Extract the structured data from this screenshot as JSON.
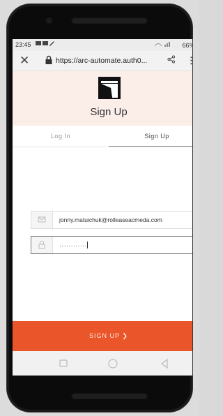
{
  "status_bar": {
    "time": "23:45",
    "battery": "66%"
  },
  "browser": {
    "url": "https://arc-automate.auth0...",
    "close_icon": "close-icon",
    "lock_icon": "lock-icon",
    "share_icon": "share-icon",
    "more_icon": "more-vert-icon"
  },
  "header": {
    "title": "Sign Up"
  },
  "tabs": [
    {
      "label": "Log In"
    },
    {
      "label": "Sign Up"
    }
  ],
  "form": {
    "email_value": "jonny.matuichuk@rolleaseacmeda.com",
    "password_value": "············"
  },
  "actions": {
    "signup_label": "SIGN UP ❯"
  },
  "colors": {
    "accent": "#ea5529",
    "header_bg": "#fbeee9"
  }
}
